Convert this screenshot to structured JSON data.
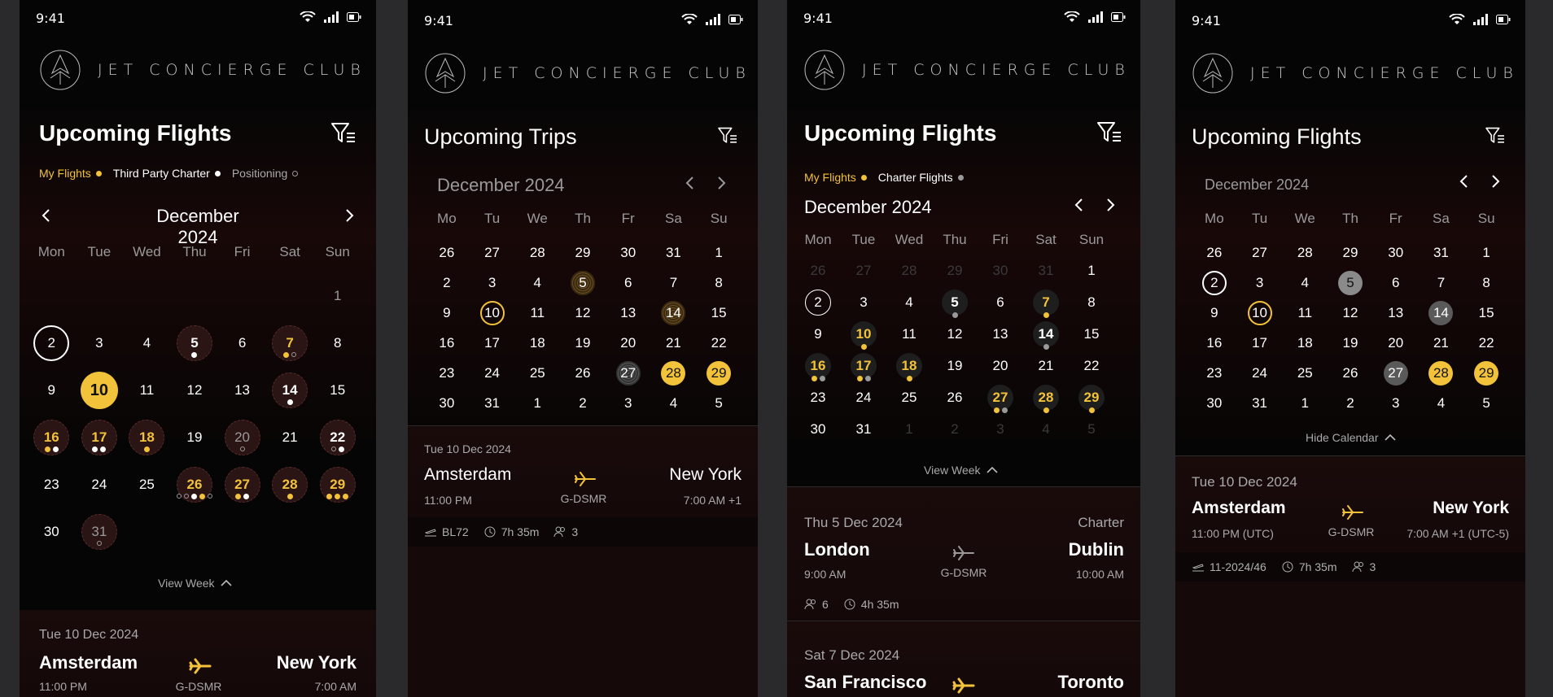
{
  "status": {
    "time": "9:41"
  },
  "brand": {
    "name": "JET CONCIERGE CLUB"
  },
  "colors": {
    "accent": "#f2c23a",
    "background": "#050505",
    "card": "#1a0b0b",
    "grey_dot": "#9a9a9a"
  },
  "screens": [
    {
      "title": "Upcoming Flights",
      "legend": [
        {
          "label": "My Flights",
          "color": "#f2c23a"
        },
        {
          "label": "Third Party Charter",
          "color": "#ffffff"
        },
        {
          "label": "Positioning",
          "color": "ring"
        }
      ],
      "month": "December 2024",
      "weekdays": [
        "Mon",
        "Tue",
        "Wed",
        "Thu",
        "Fri",
        "Sat",
        "Sun"
      ],
      "days": [
        "1",
        "2",
        "3",
        "4",
        "5",
        "6",
        "7",
        "8",
        "9",
        "10",
        "11",
        "12",
        "13",
        "14",
        "15",
        "16",
        "17",
        "18",
        "19",
        "20",
        "21",
        "22",
        "23",
        "24",
        "25",
        "26",
        "27",
        "28",
        "29",
        "30",
        "31"
      ],
      "view_week": "View Week",
      "card": {
        "date": "Tue 10 Dec 2024",
        "from": "Amsterdam",
        "from_time": "11:00 PM",
        "to": "New York",
        "to_time": "7:00 AM",
        "registration": "G-DSMR"
      }
    },
    {
      "title": "Upcoming Trips",
      "month": "December 2024",
      "weekdays": [
        "Mo",
        "Tu",
        "We",
        "Th",
        "Fr",
        "Sa",
        "Su"
      ],
      "days": [
        "26",
        "27",
        "28",
        "29",
        "30",
        "31",
        "1",
        "2",
        "3",
        "4",
        "5",
        "6",
        "7",
        "8",
        "9",
        "10",
        "11",
        "12",
        "13",
        "14",
        "15",
        "16",
        "17",
        "18",
        "19",
        "20",
        "21",
        "22",
        "23",
        "24",
        "25",
        "26",
        "27",
        "28",
        "29",
        "30",
        "31",
        "1",
        "2",
        "3",
        "4",
        "5"
      ],
      "card": {
        "date": "Tue 10 Dec 2024",
        "from": "Amsterdam",
        "from_time": "11:00 PM",
        "to": "New York",
        "to_time": "7:00 AM +1",
        "registration": "G-DSMR",
        "flight_no": "BL72",
        "duration": "7h 35m",
        "pax": "3"
      }
    },
    {
      "title": "Upcoming Flights",
      "legend": [
        {
          "label": "My Flights",
          "color": "#f2c23a"
        },
        {
          "label": "Charter Flights",
          "color": "#9a9a9a"
        }
      ],
      "month": "December 2024",
      "weekdays": [
        "Mon",
        "Tue",
        "Wed",
        "Thu",
        "Fri",
        "Sat",
        "Sun"
      ],
      "days": [
        "26",
        "27",
        "28",
        "29",
        "30",
        "31",
        "1",
        "2",
        "3",
        "4",
        "5",
        "6",
        "7",
        "8",
        "9",
        "10",
        "11",
        "12",
        "13",
        "14",
        "15",
        "16",
        "17",
        "18",
        "19",
        "20",
        "21",
        "22",
        "23",
        "24",
        "25",
        "26",
        "27",
        "28",
        "29",
        "30",
        "31",
        "1",
        "2",
        "3",
        "4",
        "5"
      ],
      "view_week": "View Week",
      "cards": [
        {
          "date": "Thu 5 Dec 2024",
          "tag": "Charter",
          "from": "London",
          "from_time": "9:00 AM",
          "to": "Dublin",
          "to_time": "10:00 AM",
          "registration": "G-DSMR",
          "pax": "6",
          "duration": "4h 35m"
        },
        {
          "date": "Sat 7 Dec 2024",
          "from": "San Francisco",
          "to": "Toronto"
        }
      ]
    },
    {
      "title": "Upcoming Flights",
      "month": "December 2024",
      "weekdays": [
        "Mo",
        "Tu",
        "We",
        "Th",
        "Fr",
        "Sa",
        "Su"
      ],
      "days": [
        "26",
        "27",
        "28",
        "29",
        "30",
        "31",
        "1",
        "2",
        "3",
        "4",
        "5",
        "6",
        "7",
        "8",
        "9",
        "10",
        "11",
        "12",
        "13",
        "14",
        "15",
        "16",
        "17",
        "18",
        "19",
        "20",
        "21",
        "22",
        "23",
        "24",
        "25",
        "26",
        "27",
        "28",
        "29",
        "30",
        "31",
        "1",
        "2",
        "3",
        "4",
        "5"
      ],
      "hide_calendar": "Hide Calendar",
      "card": {
        "date": "Tue 10 Dec 2024",
        "from": "Amsterdam",
        "from_time": "11:00 PM (UTC)",
        "to": "New York",
        "to_time": "7:00 AM +1 (UTC-5)",
        "registration": "G-DSMR",
        "flight_no": "11-2024/46",
        "duration": "7h 35m",
        "pax": "3"
      }
    }
  ]
}
